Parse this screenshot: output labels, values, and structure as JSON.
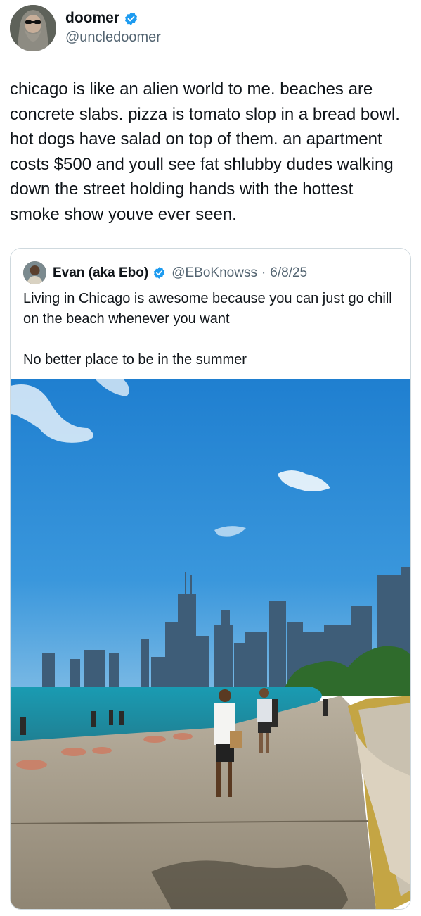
{
  "tweet": {
    "author": {
      "name": "doomer",
      "handle": "@uncledoomer",
      "verified": true
    },
    "text": "chicago is like an alien world to me. beaches are concrete slabs. pizza is tomato slop in a bread bowl. hot dogs have salad on top of them. an apartment costs $500 and youll see fat shlubby dudes walking down the street holding hands with the hottest smoke show youve ever seen."
  },
  "quoted_tweet": {
    "author": {
      "name": "Evan (aka Ebo)",
      "handle": "@EBoKnowss",
      "verified": true
    },
    "separator": "·",
    "date": "6/8/25",
    "text": "Living in Chicago is awesome because you can just go chill on the beach whenever you want\n\nNo better place to be in the summer",
    "media": {
      "kind": "photo",
      "subject": "chicago-lakefront-beach-skyline"
    }
  },
  "colors": {
    "text_primary": "#0f1419",
    "text_secondary": "#536471",
    "verified_blue": "#1d9bf0",
    "card_border": "#cfd9de",
    "sky": "#2f8fd8",
    "lake": "#1d8fa3",
    "concrete": "#a69c8a"
  },
  "icons": {
    "verified": "verified-badge-icon"
  }
}
